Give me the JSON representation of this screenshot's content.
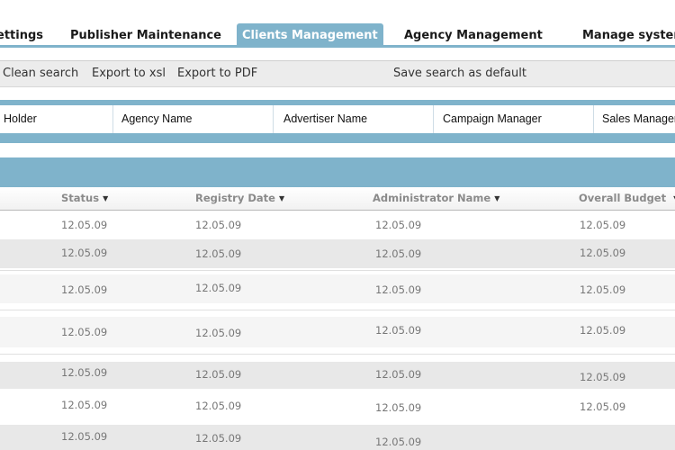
{
  "nav": {
    "tabs": [
      {
        "label": "ettings",
        "active": false
      },
      {
        "label": "Publisher Maintenance",
        "active": false
      },
      {
        "label": "Clients Management",
        "active": true
      },
      {
        "label": "Agency Management",
        "active": false
      },
      {
        "label": "Manage system",
        "active": false
      }
    ]
  },
  "toolbar": {
    "clean_search": "Clean search",
    "export_xsl": "Export to xsl",
    "export_pdf": "Export to PDF",
    "save_default": "Save search as default"
  },
  "filters": {
    "columns": [
      "Holder",
      "Agency Name",
      "Advertiser Name",
      "Campaign Manager",
      "Sales Manager"
    ]
  },
  "grid": {
    "columns": [
      "Status",
      "Registry Date",
      "Administrator Name",
      "Overall Budget"
    ],
    "rows": [
      [
        "12.05.09",
        "12.05.09",
        "12.05.09",
        "12.05.09"
      ],
      [
        "12.05.09",
        "12.05.09",
        "12.05.09",
        "12.05.09"
      ],
      [
        "12.05.09",
        "12.05.09",
        "12.05.09",
        "12.05.09"
      ],
      [
        "12.05.09",
        "12.05.09",
        "12.05.09",
        "12.05.09"
      ],
      [
        "12.05.09",
        "12.05.09",
        "12.05.09",
        "12.05.09"
      ],
      [
        "12.05.09",
        "12.05.09",
        "12.05.09",
        "12.05.09"
      ],
      [
        "12.05.09",
        "12.05.09",
        "12.05.09",
        ""
      ]
    ]
  },
  "colors": {
    "accent": "#7fb3cb",
    "toolbar_bg": "#ececec",
    "row_grey": "#e8e8e8"
  },
  "icons": {
    "sort": "sort-down-arrow-icon"
  }
}
